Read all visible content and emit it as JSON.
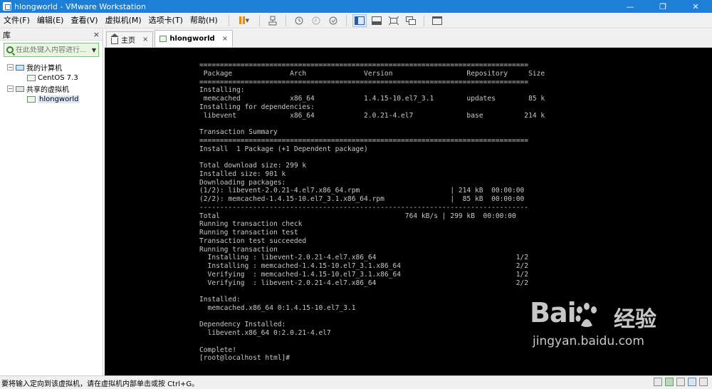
{
  "window": {
    "title": "hlongworld - VMware Workstation",
    "controls": {
      "minimize": "—",
      "restore": "❐",
      "close": "✕"
    }
  },
  "menu": [
    "文件(F)",
    "编辑(E)",
    "查看(V)",
    "虚拟机(M)",
    "选项卡(T)",
    "帮助(H)"
  ],
  "sidebar": {
    "header": "库",
    "close": "×",
    "search_placeholder": "在此处键入内容进行...",
    "tree": {
      "my_computer": "我的计算机",
      "my_computer_children": [
        "CentOS 7.3"
      ],
      "shared": "共享的虚拟机",
      "shared_children": [
        "hlongworld"
      ]
    }
  },
  "tabs": [
    {
      "label": "主页",
      "close": "×"
    },
    {
      "label": "hlongworld",
      "close": "×"
    }
  ],
  "terminal": {
    "lines": [
      "================================================================================",
      " Package              Arch              Version                  Repository     Size",
      "================================================================================",
      "Installing:",
      " memcached            x86_64            1.4.15-10.el7_3.1        updates        85 k",
      "Installing for dependencies:",
      " libevent             x86_64            2.0.21-4.el7             base          214 k",
      "",
      "Transaction Summary",
      "================================================================================",
      "Install  1 Package (+1 Dependent package)",
      "",
      "Total download size: 299 k",
      "Installed size: 901 k",
      "Downloading packages:",
      "(1/2): libevent-2.0.21-4.el7.x86_64.rpm                      | 214 kB  00:00:00",
      "(2/2): memcached-1.4.15-10.el7_3.1.x86_64.rpm                |  85 kB  00:00:00",
      "--------------------------------------------------------------------------------",
      "Total                                             764 kB/s | 299 kB  00:00:00",
      "Running transaction check",
      "Running transaction test",
      "Transaction test succeeded",
      "Running transaction",
      "  Installing : libevent-2.0.21-4.el7.x86_64                                  1/2",
      "  Installing : memcached-1.4.15-10.el7_3.1.x86_64                            2/2",
      "  Verifying  : memcached-1.4.15-10.el7_3.1.x86_64                            1/2",
      "  Verifying  : libevent-2.0.21-4.el7.x86_64                                  2/2",
      "",
      "Installed:",
      "  memcached.x86_64 0:1.4.15-10.el7_3.1",
      "",
      "Dependency Installed:",
      "  libevent.x86_64 0:2.0.21-4.el7",
      "",
      "Complete!",
      "[root@localhost html]#"
    ]
  },
  "watermark": {
    "brand": "Bai",
    "brand_suffix": "经验",
    "url": "jingyan.baidu.com"
  },
  "status": {
    "message": "要将输入定向到该虚拟机，请在虚拟机内部单击或按 Ctrl+G。"
  }
}
